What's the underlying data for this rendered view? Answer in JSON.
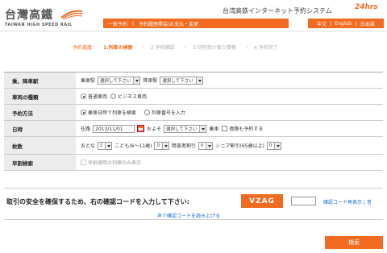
{
  "header": {
    "logo_text": "台灣高鐵",
    "logo_subtext": "TAIWAN HIGH SPEED RAIL",
    "system_title": "台湾高鉄インターネット予約システム",
    "hours_badge": "24hrs",
    "nav": [
      "一般予約",
      "予約履歴照会/お支払・変更"
    ],
    "languages": [
      "中文",
      "English",
      "日本語"
    ]
  },
  "progress": {
    "label": "予約進度：",
    "steps": [
      "1.列車の検索",
      "2.予約確認",
      "3.切符受け取り情報",
      "4.予約完了"
    ]
  },
  "form": {
    "stations": {
      "label": "乗、降車駅",
      "board_label": "乗車駅",
      "board_value": "選択して下さい",
      "alight_label": "降車駅",
      "alight_value": "選択して下さい"
    },
    "car_type": {
      "label": "車両の種類",
      "options": [
        "普通車両",
        "ビジネス車両"
      ]
    },
    "booking_method": {
      "label": "予約方法",
      "options": [
        "乗車日時で列車を検索",
        "列車番号を入力"
      ]
    },
    "date": {
      "label": "日時",
      "outbound_label": "往路",
      "date_value": "2013/11/01",
      "approx_label": "およそ",
      "time_value": "選択して下さい",
      "depart_label": "乗車",
      "return_label": "復路も予約する"
    },
    "tickets": {
      "label": "枚数",
      "adult_label": "おとな",
      "adult_value": "1",
      "child_label": "こども(6～11歳)",
      "child_value": "0",
      "disabled_label": "障害者割引",
      "disabled_value": "0",
      "senior_label": "シニア割引(65歳以上)",
      "senior_value": "0"
    },
    "early": {
      "label": "早割検索",
      "option": "早割適用の列車のみ表示"
    }
  },
  "verify": {
    "instruction": "取引の安全を確保するため、右の確認コードを入力して下さい:",
    "code": "VZAG",
    "reissue_link": "確認コード再表示",
    "sep": "|",
    "reissue_link2": "音",
    "audio_link": "声で確認コードを読み上げる"
  },
  "search_button": "検索",
  "colors": {
    "accent": "#f26b21",
    "link": "#1a6ad1"
  }
}
